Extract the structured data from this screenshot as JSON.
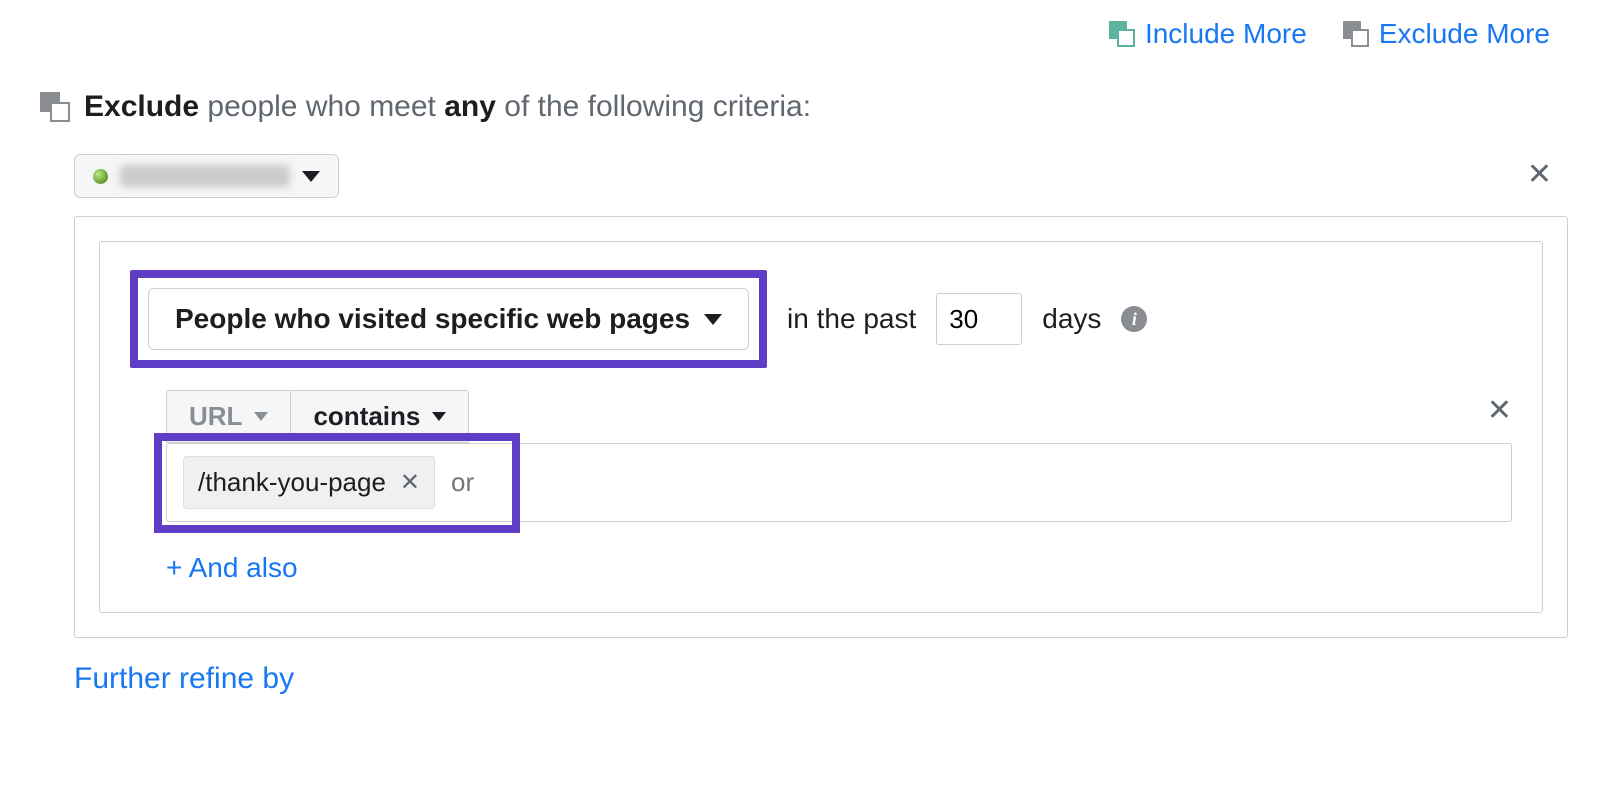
{
  "toolbar": {
    "include_more": "Include More",
    "exclude_more": "Exclude More"
  },
  "headline": {
    "exclude": "Exclude",
    "middle": " people who meet ",
    "any": "any",
    "end": " of the following criteria:"
  },
  "source": {
    "label_hidden": "pixel source"
  },
  "criteria": {
    "audience_type": "People who visited specific web pages",
    "in_the_past": "in the past",
    "days_value": "30",
    "days_label": "days",
    "url_label": "URL",
    "operator": "contains",
    "chip_value": "/thank-you-page",
    "or_placeholder": "or",
    "and_also": "+ And also"
  },
  "further_refine": "Further refine by"
}
